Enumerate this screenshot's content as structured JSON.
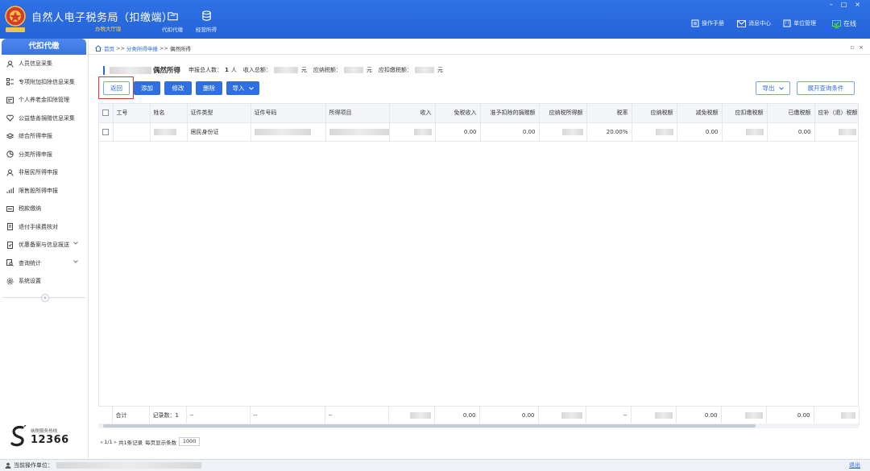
{
  "app": {
    "title": "自然人电子税务局（扣缴端）",
    "subtitle": "办税大厅版"
  },
  "top_nav": [
    {
      "label": "代扣代缴",
      "icon": "folder-icon"
    },
    {
      "label": "经营所得",
      "icon": "coins-icon"
    }
  ],
  "tools": [
    {
      "label": "操作手册",
      "icon": "manual-icon"
    },
    {
      "label": "消息中心",
      "icon": "mail-icon"
    },
    {
      "label": "单位管理",
      "icon": "building-icon"
    },
    {
      "label": "在线",
      "icon": "online-icon"
    }
  ],
  "window_controls": [
    "–",
    "□",
    "×"
  ],
  "sidebar": {
    "header": "代扣代缴",
    "items": [
      {
        "label": "人员信息采集",
        "icon": "person-icon"
      },
      {
        "label": "专项附加扣除信息采集",
        "icon": "list-icon"
      },
      {
        "label": "个人养老金扣除管理",
        "icon": "id-card-icon"
      },
      {
        "label": "公益慈善捐赠信息采集",
        "icon": "donation-icon"
      },
      {
        "label": "综合所得申报",
        "icon": "layers-icon"
      },
      {
        "label": "分类所得申报",
        "icon": "pie-icon"
      },
      {
        "label": "非居民所得申报",
        "icon": "user-icon"
      },
      {
        "label": "限售股所得申报",
        "icon": "bar-chart-icon"
      },
      {
        "label": "税款缴纳",
        "icon": "tax-icon"
      },
      {
        "label": "退付手续费核对",
        "icon": "document-icon"
      },
      {
        "label": "优惠备案与信息报送",
        "icon": "document-check-icon",
        "expandable": true
      },
      {
        "label": "查询统计",
        "icon": "search-doc-icon",
        "expandable": true
      },
      {
        "label": "系统设置",
        "icon": "gear-icon"
      }
    ],
    "collapse_glyph": "«",
    "hotline_label": "纳税服务热线",
    "hotline_number": "12366"
  },
  "breadcrumb": {
    "home": "首页",
    "sep": ">>",
    "parent": "分类所得申报",
    "current": "偶然所得",
    "controls": [
      "▫",
      "×"
    ]
  },
  "summary": {
    "title": "偶然所得",
    "count_label": "申报总人数：",
    "count_value": "1",
    "count_unit": "人",
    "income_label": "收入总额：",
    "income_unit": "元",
    "tax_payable_label": "应纳税额：",
    "tax_payable_unit": "元",
    "withheld_label": "应扣缴税额：",
    "withheld_unit": "元"
  },
  "toolbar": {
    "back": "返回",
    "add": "添加",
    "edit": "修改",
    "delete": "删除",
    "import": "导入",
    "export": "导出",
    "expand_query": "展开查询条件"
  },
  "table": {
    "columns": [
      "工号",
      "姓名",
      "证件类型",
      "证件号码",
      "所得项目",
      "收入",
      "免税收入",
      "准予扣除的捐赠额",
      "应纳税所得额",
      "税率",
      "应纳税额",
      "减免税额",
      "应扣缴税额",
      "已缴税额",
      "应补（退）税额"
    ],
    "rows": [
      {
        "id_type": "居民身份证",
        "tax_free_income": "0.00",
        "donation": "0.00",
        "tax_rate": "20.00%",
        "reduction": "0.00",
        "paid": "0.00"
      }
    ],
    "total": {
      "label": "合计",
      "records": "记录数：1",
      "dash": "--",
      "tax_free_income": "0.00",
      "donation": "0.00",
      "reduction": "0.00",
      "paid": "0.00"
    }
  },
  "pager": {
    "page": "1/1",
    "total_text": "共1条记录",
    "per_page_label": "每页显示条数",
    "per_page_value": "1000"
  },
  "status": {
    "operator_label": "当前操作单位：",
    "logout": "退出"
  }
}
